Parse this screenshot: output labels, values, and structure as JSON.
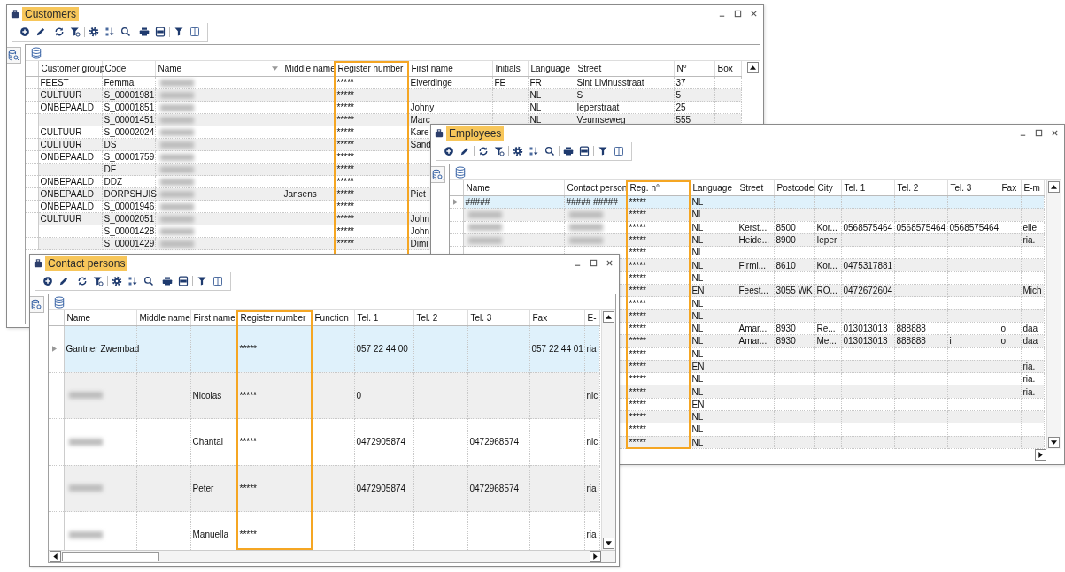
{
  "customers": {
    "title": "Customers",
    "columns": [
      {
        "label": "Customer group",
        "highlighted": false
      },
      {
        "label": "Code",
        "highlighted": false
      },
      {
        "label": "Name",
        "highlighted": false
      },
      {
        "label": "Middle name",
        "highlighted": false
      },
      {
        "label": "Register number",
        "highlighted": true
      },
      {
        "label": "First name",
        "highlighted": false
      },
      {
        "label": "Initials",
        "highlighted": false
      },
      {
        "label": "Language",
        "highlighted": false
      },
      {
        "label": "Street",
        "highlighted": false
      },
      {
        "label": "N°",
        "highlighted": false
      },
      {
        "label": "Box",
        "highlighted": false
      }
    ],
    "rows": [
      {
        "selected": false,
        "name_blurred": true,
        "customer_group": "FEEST",
        "code": "Femma",
        "register_number": "*****",
        "first_name": "Elverdinge",
        "initials": "FE",
        "language": "FR",
        "street": "Sint Livinusstraat",
        "number": "37"
      },
      {
        "selected": false,
        "name_blurred": true,
        "customer_group": "CULTUUR",
        "code": "S_00001981",
        "register_number": "*****",
        "language": "NL",
        "street": "S",
        "number": "5"
      },
      {
        "selected": false,
        "name_blurred": true,
        "customer_group": "ONBEPAALD",
        "code": "S_00001851",
        "register_number": "*****",
        "first_name": "Johny",
        "language": "NL",
        "street": "Ieperstraat",
        "number": "25"
      },
      {
        "selected": false,
        "name_blurred": true,
        "code": "S_00001451",
        "register_number": "*****",
        "first_name": "Marc",
        "language": "NL",
        "street": "Veurnseweg",
        "number": "555"
      },
      {
        "selected": false,
        "name_blurred": true,
        "customer_group": "CULTUUR",
        "code": "S_00002024",
        "register_number": "*****",
        "first_name": "Kare"
      },
      {
        "selected": false,
        "name_blurred": true,
        "customer_group": "CULTUUR",
        "code": "DS",
        "register_number": "*****",
        "first_name": "Sand"
      },
      {
        "selected": false,
        "name_blurred": true,
        "customer_group": "ONBEPAALD",
        "code": "S_00001759",
        "register_number": "*****"
      },
      {
        "selected": false,
        "name_blurred": true,
        "code": "DE",
        "register_number": "*****"
      },
      {
        "selected": false,
        "name_blurred": true,
        "customer_group": "ONBEPAALD",
        "code": "DDZ",
        "register_number": "*****"
      },
      {
        "selected": false,
        "name_blurred": true,
        "customer_group": "ONBEPAALD",
        "code": "DORPSHUIS",
        "middle_name": "Jansens",
        "register_number": "*****",
        "first_name": "Piet"
      },
      {
        "selected": false,
        "name_blurred": true,
        "customer_group": "ONBEPAALD",
        "code": "S_00001946",
        "register_number": "*****"
      },
      {
        "selected": false,
        "name_blurred": true,
        "customer_group": "CULTUUR",
        "code": "S_00002051",
        "register_number": "*****",
        "first_name": "John"
      },
      {
        "selected": false,
        "name_blurred": true,
        "code": "S_00001428",
        "register_number": "*****",
        "first_name": "John"
      },
      {
        "selected": false,
        "name_blurred": true,
        "code": "S_00001429",
        "register_number": "*****",
        "first_name": "Dimi"
      }
    ]
  },
  "employees": {
    "title": "Employees",
    "columns": [
      {
        "label": "Name",
        "highlighted": false
      },
      {
        "label": "Contact person",
        "highlighted": false
      },
      {
        "label": "Reg. n°",
        "highlighted": true
      },
      {
        "label": "Language",
        "highlighted": false
      },
      {
        "label": "Street",
        "highlighted": false
      },
      {
        "label": "Postcode",
        "highlighted": false
      },
      {
        "label": "City",
        "highlighted": false
      },
      {
        "label": "Tel. 1",
        "highlighted": false
      },
      {
        "label": "Tel. 2",
        "highlighted": false
      },
      {
        "label": "Tel. 3",
        "highlighted": false
      },
      {
        "label": "Fax",
        "highlighted": false
      },
      {
        "label": "E-m",
        "highlighted": false
      }
    ],
    "rows": [
      {
        "selected": true,
        "name": "#####",
        "contact_person": "##### #####",
        "reg_no": "*****",
        "language": "NL"
      },
      {
        "selected": false,
        "name_blurred": true,
        "contact_person_blurred": true,
        "reg_no": "*****",
        "language": "NL"
      },
      {
        "selected": false,
        "name_blurred": true,
        "contact_person_blurred": true,
        "reg_no": "*****",
        "language": "NL",
        "street": "Kerst...",
        "postcode": "8500",
        "city": "Kor...",
        "tel_1": "0568575464",
        "tel_2": "0568575464",
        "tel_3": "0568575464",
        "email": "elie"
      },
      {
        "selected": false,
        "name_blurred": true,
        "contact_person_blurred": true,
        "reg_no": "*****",
        "language": "NL",
        "street": "Heide...",
        "postcode": "8900",
        "city": "Ieper",
        "email": "ria."
      },
      {
        "selected": false,
        "reg_no": "*****",
        "language": "NL"
      },
      {
        "selected": false,
        "reg_no": "*****",
        "language": "NL",
        "street": "Firmi...",
        "postcode": "8610",
        "city": "Kor...",
        "tel_1": "0475317881"
      },
      {
        "selected": false,
        "reg_no": "*****",
        "language": "NL"
      },
      {
        "selected": false,
        "reg_no": "*****",
        "language": "EN",
        "street": "Feest...",
        "postcode": "3055 WK",
        "city": "RO...",
        "tel_1": "0472672604",
        "email": "Mich"
      },
      {
        "selected": false,
        "reg_no": "*****",
        "language": "NL"
      },
      {
        "selected": false,
        "reg_no": "*****",
        "language": "NL"
      },
      {
        "selected": false,
        "reg_no": "*****",
        "language": "NL",
        "street": "Amar...",
        "postcode": "8930",
        "city": "Re...",
        "tel_1": "013013013",
        "tel_2": "888888",
        "fax": "o",
        "email": "daa"
      },
      {
        "selected": false,
        "reg_no": "*****",
        "language": "NL",
        "street": "Amar...",
        "postcode": "8930",
        "city": "Me...",
        "tel_1": "013013013",
        "tel_2": "888888",
        "tel_3": "i",
        "fax": "o",
        "email": "daa"
      },
      {
        "selected": false,
        "reg_no": "*****",
        "language": "NL"
      },
      {
        "selected": false,
        "reg_no": "*****",
        "language": "EN",
        "email": "ria."
      },
      {
        "selected": false,
        "reg_no": "*****",
        "language": "NL",
        "email": "ria."
      },
      {
        "selected": false,
        "reg_no": "*****",
        "language": "NL",
        "email": "ria."
      },
      {
        "selected": false,
        "reg_no": "*****",
        "language": "EN"
      },
      {
        "selected": false,
        "reg_no": "*****",
        "language": "NL"
      },
      {
        "selected": false,
        "reg_no": "*****",
        "language": "NL"
      },
      {
        "selected": false,
        "reg_no": "*****",
        "language": "NL"
      }
    ]
  },
  "contact_persons": {
    "title": "Contact persons",
    "columns": [
      {
        "label": "Name",
        "highlighted": false
      },
      {
        "label": "Middle name",
        "highlighted": false
      },
      {
        "label": "First name",
        "highlighted": false
      },
      {
        "label": "Register number",
        "highlighted": true
      },
      {
        "label": "Function",
        "highlighted": false
      },
      {
        "label": "Tel. 1",
        "highlighted": false
      },
      {
        "label": "Tel. 2",
        "highlighted": false
      },
      {
        "label": "Tel. 3",
        "highlighted": false
      },
      {
        "label": "Fax",
        "highlighted": false
      },
      {
        "label": "E-",
        "highlighted": false
      }
    ],
    "rows": [
      {
        "selected": true,
        "name": "Gantner Zwembad",
        "register_number": "*****",
        "tel_1": "057 22 44 00",
        "fax": "057 22 44 01",
        "email": "ria"
      },
      {
        "selected": false,
        "name_blurred": true,
        "first_name": "Nicolas",
        "register_number": "*****",
        "tel_1": "0",
        "email": "nic"
      },
      {
        "selected": false,
        "name_blurred": true,
        "first_name": "Chantal",
        "register_number": "*****",
        "tel_1": "0472905874",
        "tel_3": "0472968574",
        "email": "nic"
      },
      {
        "selected": false,
        "name_blurred": true,
        "first_name": "Peter",
        "register_number": "*****",
        "tel_1": "0472905874",
        "tel_3": "0472968574",
        "email": "ria"
      },
      {
        "selected": false,
        "name_blurred": true,
        "first_name": "Manuella",
        "register_number": "*****",
        "email": "ria"
      }
    ]
  }
}
